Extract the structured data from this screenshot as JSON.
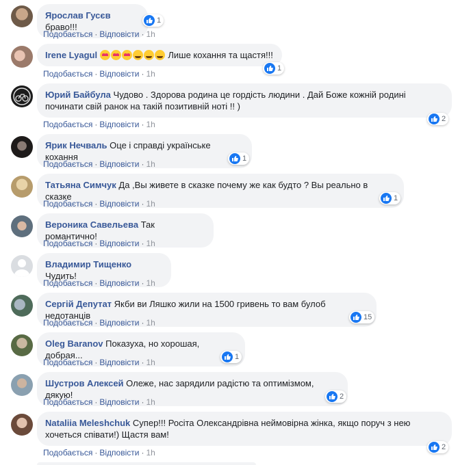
{
  "actions": {
    "like": "Подобається",
    "reply": "Відповісти",
    "separator": "·"
  },
  "comments": [
    {
      "author": "Ярослав Гусєв",
      "text": "браво!!!",
      "time": "1h",
      "reactions": "1"
    },
    {
      "author": "Irene Lyagul",
      "text": "Лише кохання та щастя!!!",
      "time": "1h",
      "reactions": "1"
    },
    {
      "author": "Юрий Байбула",
      "text": "Чудово . Здорова родина це гордість людини . Дай Боже кожній родині починати свій ранок на такій позитивній ноті !! )",
      "time": "1h",
      "reactions": "2"
    },
    {
      "author": "Ярик Нечваль",
      "text": "Оце і справді українське кохання",
      "time": "1h",
      "reactions": "1"
    },
    {
      "author": "Татьяна Симчук",
      "text": "Да ,Вы живете в сказке почему же как будто ? Вы реально в сказке",
      "time": "1h",
      "reactions": "1"
    },
    {
      "author": "Вероника Савельева",
      "text": "Так романтично!",
      "time": "1h",
      "reactions": ""
    },
    {
      "author": "Владимир Тищенко",
      "text": "Чудить!",
      "time": "1h",
      "reactions": ""
    },
    {
      "author": "Сергій Депутат",
      "text": "Якби ви Ляшко жили на 1500 гривень то вам булоб недотанців",
      "time": "1h",
      "reactions": "15"
    },
    {
      "author": "Oleg Baranov",
      "text": "Показуха, но хорошая, добрая...",
      "time": "1h",
      "reactions": "1"
    },
    {
      "author": "Шустров Алексей",
      "text": "Олеже, нас зарядили радістю та оптимізмом, дякую!",
      "time": "1h",
      "reactions": "2"
    },
    {
      "author": "Nataliia Meleshchuk",
      "text": "Супер!!! Росіта Олександрівна неймовірна жінка, якщо поруч з нею хочеться співати!) Щастя вам!",
      "time": "1h",
      "reactions": "2"
    }
  ],
  "colors": {
    "author": "#385898",
    "bubble": "#f2f3f5",
    "like": "#1877f2"
  }
}
